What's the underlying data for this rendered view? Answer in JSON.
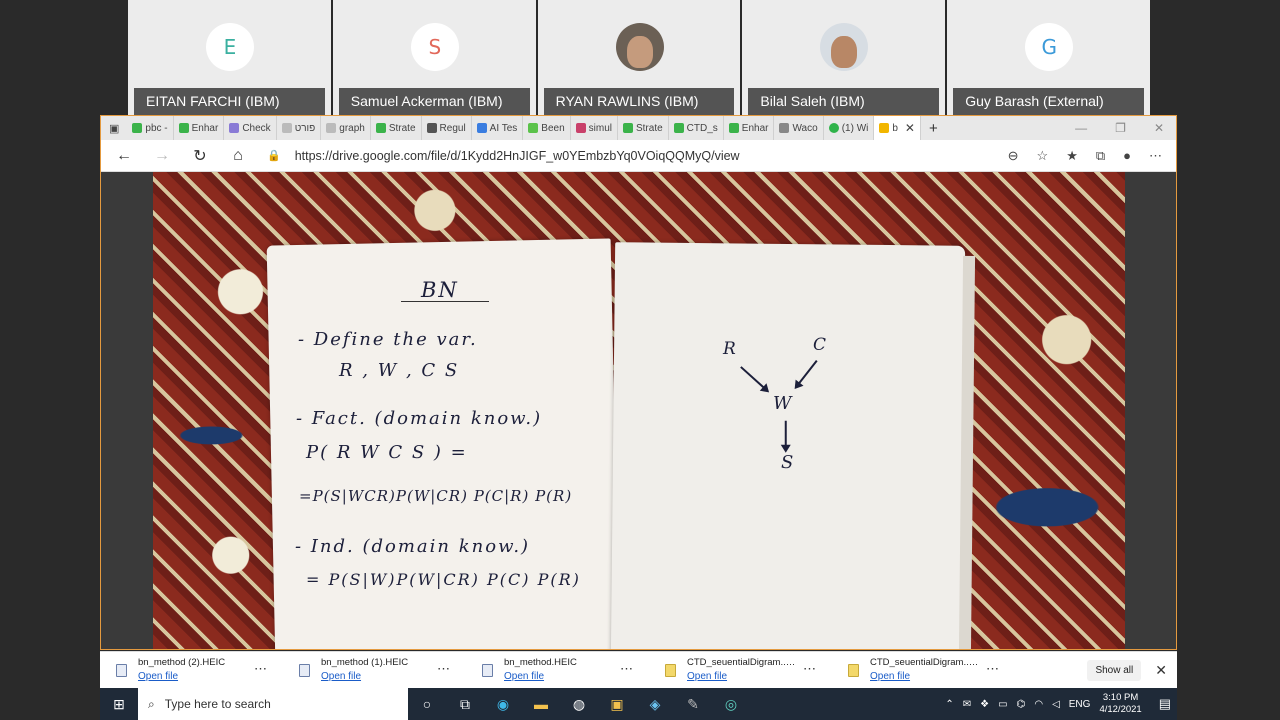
{
  "participants": [
    {
      "initial": "E",
      "initial_color": "#3ab0a0",
      "name": "EITAN FARCHI (IBM)"
    },
    {
      "initial": "S",
      "initial_color": "#e2685a",
      "name": "Samuel Ackerman (IBM)"
    },
    {
      "initial": "",
      "name": "RYAN RAWLINS (IBM)"
    },
    {
      "initial": "",
      "name": "Bilal Saleh (IBM)"
    },
    {
      "initial": "G",
      "initial_color": "#3b9ad9",
      "name": "Guy Barash (External)"
    }
  ],
  "browser": {
    "tabs": [
      "pbc -",
      "Enhar",
      "Check",
      "פורט",
      "graph",
      "Strate",
      "Regul",
      "AI Tes",
      "Been",
      "simul",
      "Strate",
      "CTD_s",
      "Enhar",
      "Waco",
      "(1) Wi",
      "b"
    ],
    "url": "https://drive.google.com/file/d/1Kydd2HnJIGF_w0YEmbzbYq0VOiqQQMyQ/view"
  },
  "notebook": {
    "title": "BN",
    "lines": [
      "- Define the var.",
      "R , W , C   S",
      "- Fact. (domain know.)",
      "P( R W C S ) =",
      "=P(S|WCR)P(W|CR) P(C|R) P(R)",
      "- Ind. (domain know.)",
      "= P(S|W)P(W|CR) P(C) P(R)"
    ],
    "diagram_nodes": [
      "R",
      "C",
      "W",
      "S"
    ]
  },
  "zoom": {
    "minus": "−",
    "magnifier": "🔍",
    "plus": "+"
  },
  "downloads": [
    {
      "name": "bn_method (2).HEIC",
      "action": "Open file",
      "type": "file"
    },
    {
      "name": "bn_method (1).HEIC",
      "action": "Open file",
      "type": "file"
    },
    {
      "name": "bn_method.HEIC",
      "action": "Open file",
      "type": "file"
    },
    {
      "name": "CTD_seuentialDigram....z...",
      "action": "Open file",
      "type": "zip"
    },
    {
      "name": "CTD_seuentialDigram....z...",
      "action": "Open file",
      "type": "zip"
    }
  ],
  "show_all": "Show all",
  "taskbar": {
    "search_placeholder": "Type here to search",
    "language": "ENG",
    "time": "3:10 PM",
    "date": "4/12/2021"
  }
}
